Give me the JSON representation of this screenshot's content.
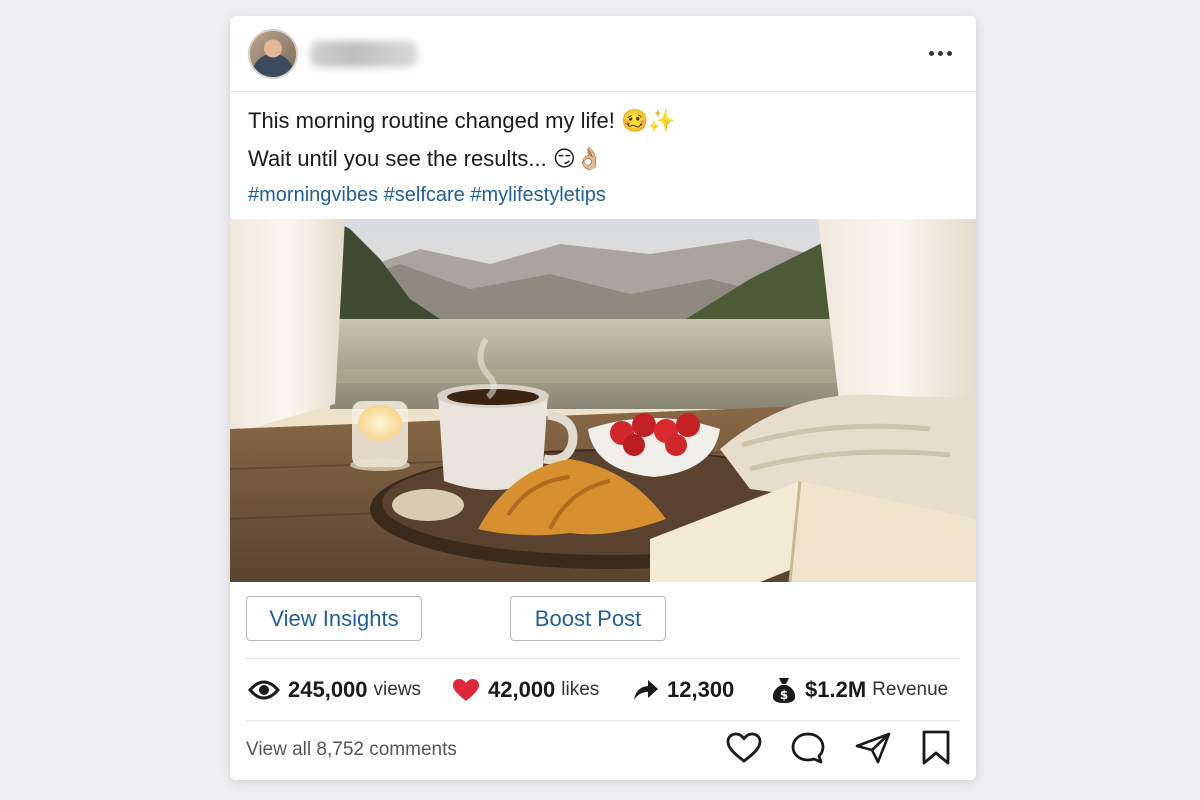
{
  "post": {
    "author_name": "████████",
    "caption_line1": "This morning routine changed my life! 🥴✨",
    "caption_line2": "Wait until you see the results... 😏👌🏼",
    "hashtags": "#morningvibes #selfcare #mylifestyletips",
    "image_alt": "Breakfast tray with coffee, croissant, strawberries, candle and an open book on a wooden deck overlooking a mountain lake at sunrise"
  },
  "actions": {
    "insights_label": "View Insights",
    "boost_label": "Boost Post"
  },
  "stats": {
    "views_value": "245,000",
    "views_unit": "views",
    "likes_value": "42,000",
    "likes_unit": "likes",
    "shares_value": "12,300",
    "revenue_value": "$1.2M",
    "revenue_unit": "Revenue"
  },
  "footer": {
    "comments_label": "View all 8,752 comments"
  },
  "icons": {
    "more": "more-dots-icon",
    "views": "eye-icon",
    "likes": "heart-filled-icon",
    "shares": "share-arrow-icon",
    "revenue": "money-bag-icon",
    "like": "heart-outline-icon",
    "comment": "comment-icon",
    "send": "send-icon",
    "save": "bookmark-icon"
  },
  "colors": {
    "link_blue": "#1f5f9e",
    "heart_red": "#e0283b",
    "background": "#eeeef1"
  }
}
